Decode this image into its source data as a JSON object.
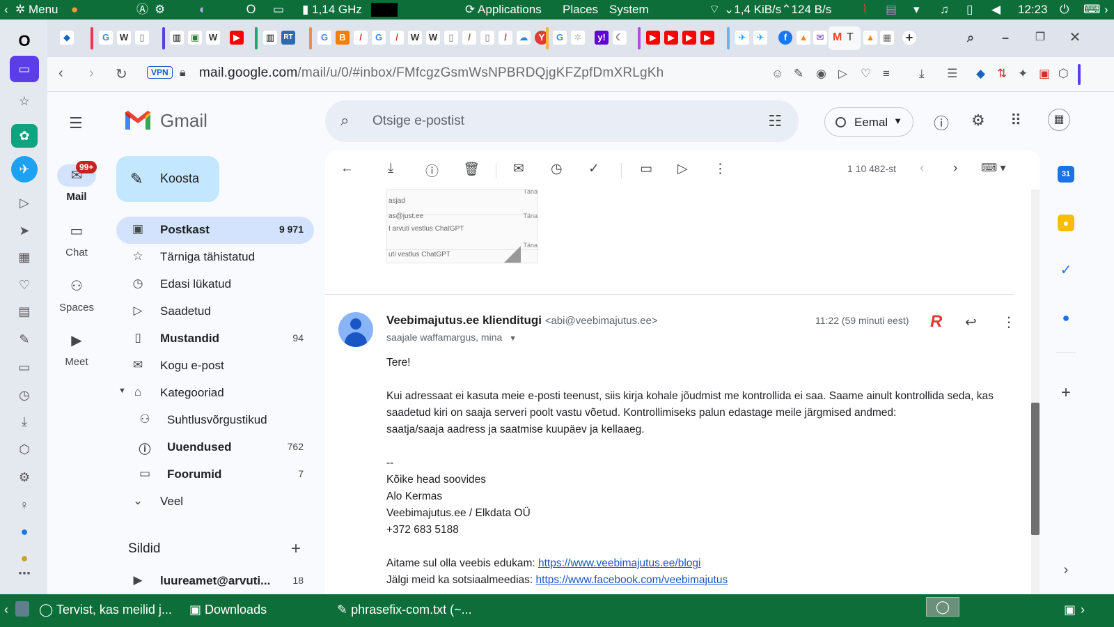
{
  "system_panel": {
    "menu_label": "Menu",
    "cpu": "1,14 GHz",
    "applications": "Applications",
    "places": "Places",
    "system": "System",
    "net_down": "1,4 KiB/s",
    "net_up": "124 B/s",
    "clock": "12:23"
  },
  "browser": {
    "vpn": "VPN",
    "url_host": "mail.google.com",
    "url_path": "/mail/u/0/#inbox/FMfcgzGsmWsNPBRDQjgKFZpfDmXRLgKh"
  },
  "gmail": {
    "app_name": "Gmail",
    "search_placeholder": "Otsige e-postist",
    "status_label": "Eemal",
    "rail": {
      "mail": "Mail",
      "mail_badge": "99+",
      "chat": "Chat",
      "spaces": "Spaces",
      "meet": "Meet"
    },
    "compose": "Koosta",
    "nav": [
      {
        "label": "Postkast",
        "count": "9 971"
      },
      {
        "label": "Tärniga tähistatud",
        "count": ""
      },
      {
        "label": "Edasi lükatud",
        "count": ""
      },
      {
        "label": "Saadetud",
        "count": ""
      },
      {
        "label": "Mustandid",
        "count": "94"
      },
      {
        "label": "Kogu e-post",
        "count": ""
      },
      {
        "label": "Kategooriad",
        "count": ""
      },
      {
        "label": "Suhtlusvõrgustikud",
        "count": ""
      },
      {
        "label": "Uuendused",
        "count": "762"
      },
      {
        "label": "Foorumid",
        "count": "7"
      },
      {
        "label": "Veel",
        "count": ""
      }
    ],
    "labels_heading": "Sildid",
    "label_items": [
      {
        "label": "luureamet@arvuti...",
        "count": "18"
      }
    ],
    "toolbar_count": "1 10 482-st",
    "thumbnail_rows": [
      {
        "text": "asjad",
        "time": "Täna"
      },
      {
        "text": "as@just.ee",
        "time": "Täna"
      },
      {
        "text": "I arvuti vestlus ChatGPT",
        "time": ""
      },
      {
        "text": "uti vestlus ChatGPT",
        "time": "Täna"
      }
    ],
    "message": {
      "sender_name": "Veebimajutus.ee klienditugi",
      "sender_addr": "<abi@veebimajutus.ee>",
      "recipients": "saajale waffamargus, mina",
      "time": "11:22 (59 minuti eest)",
      "body": [
        "Tere!",
        "",
        "Kui adressaat ei kasuta meie e-posti teenust, siis kirja kohale jõudmist me kontrollida ei saa. Saame ainult kontrollida seda, kas saadetud kiri on saaja serveri poolt vastu võetud. Kontrollimiseks palun edastage meile järgmised andmed:",
        "saatja/saaja aadress ja saatmise kuupäev ja kellaaeg.",
        "",
        "--",
        "Kõike head soovides",
        "Alo Kermas",
        "Veebimajutus.ee / Elkdata OÜ",
        "+372 683 5188",
        ""
      ],
      "link_intro": "Aitame sul olla veebis edukam: ",
      "link_url": "https://www.veebimajutus.ee/blogi",
      "social_intro": "Jälgi meid ka sotsiaalmeedias: ",
      "social_url": "https://www.facebook.com/veebimajutus"
    }
  },
  "taskbar": {
    "task1": "Tervist, kas meilid j...",
    "task2": "Downloads",
    "task3": "phrasefix-com.txt (~..."
  },
  "colors": {
    "panel_green": "#0d6e3a",
    "compose_blue": "#c2e7ff",
    "active_nav": "#d3e3fd",
    "badge_red": "#c5221f",
    "link_blue": "#1a56c4"
  }
}
